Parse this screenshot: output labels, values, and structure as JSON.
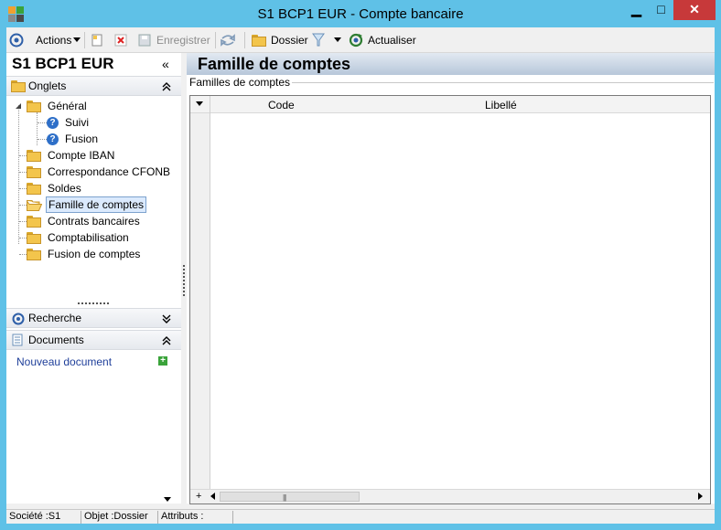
{
  "window": {
    "title": "S1 BCP1 EUR -  Compte bancaire",
    "controls": {
      "minimize": "▁",
      "maximize": "□",
      "close": "✕"
    }
  },
  "toolbar": {
    "actions_label": "Actions",
    "enregistrer_label": "Enregistrer",
    "dossier_label": "Dossier",
    "actualiser_label": "Actualiser"
  },
  "left": {
    "header_title": "S1 BCP1 EUR",
    "collapse_glyph": "«",
    "sections": {
      "onglets": {
        "label": "Onglets",
        "toggle": "⌃"
      },
      "recherche": {
        "label": "Recherche",
        "toggle": "⌄"
      },
      "documents": {
        "label": "Documents",
        "toggle": "⌃"
      }
    },
    "tree": [
      {
        "label": "Général",
        "icon": "folder-icon"
      },
      {
        "label": "Suivi",
        "icon": "help-icon"
      },
      {
        "label": "Fusion",
        "icon": "help-icon"
      },
      {
        "label": "Compte IBAN",
        "icon": "folder-icon"
      },
      {
        "label": "Correspondance CFONB",
        "icon": "folder-icon"
      },
      {
        "label": "Soldes",
        "icon": "folder-icon"
      },
      {
        "label": "Famille de comptes",
        "icon": "folder-open-icon",
        "selected": true
      },
      {
        "label": "Contrats bancaires",
        "icon": "folder-icon"
      },
      {
        "label": "Comptabilisation",
        "icon": "folder-icon"
      },
      {
        "label": "Fusion de comptes",
        "icon": "folder-icon"
      }
    ],
    "nouveau_document": "Nouveau document"
  },
  "right": {
    "title": "Famille de comptes",
    "group_label": "Familles de comptes",
    "grid": {
      "columns": [
        "Code",
        "Libellé"
      ],
      "rows": [],
      "add_glyph": "+"
    }
  },
  "status": {
    "societe": "Société :S1",
    "objet": "Objet :Dossier",
    "attributs": "Attributs :"
  },
  "colors": {
    "frame": "#5fc1e7",
    "close_button": "#c7393a",
    "link": "#1f3f9a"
  }
}
